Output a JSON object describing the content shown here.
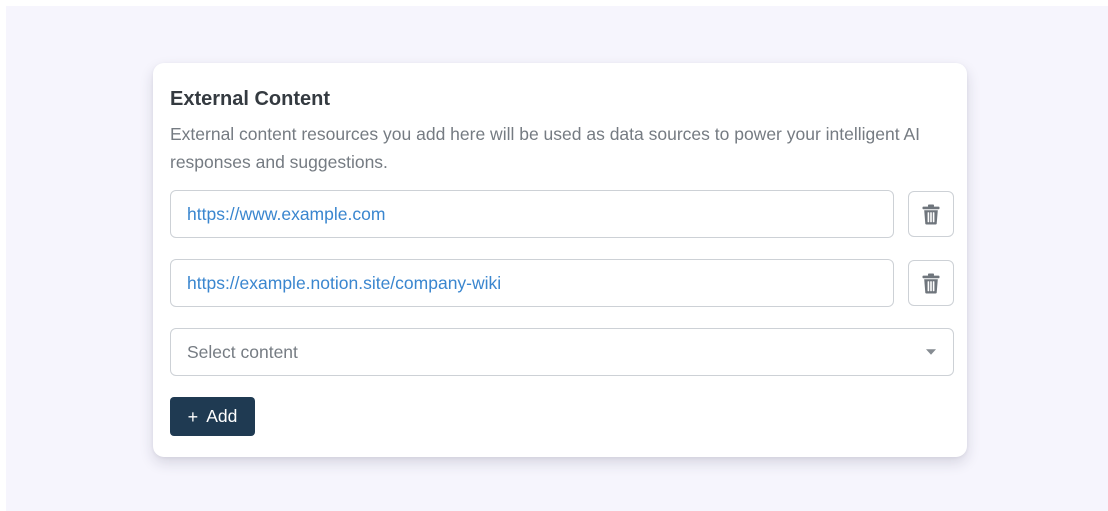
{
  "external_content": {
    "title": "External Content",
    "description": "External content resources you add here will be used as data sources to power your intelligent AI responses and suggestions.",
    "sources": [
      {
        "url": "https://www.example.com"
      },
      {
        "url": "https://example.notion.site/company-wiki"
      }
    ],
    "select": {
      "placeholder": "Select content"
    },
    "add_button": {
      "icon": "+",
      "label": "Add"
    }
  },
  "colors": {
    "page_background": "#f6f5fd",
    "card_background": "#ffffff",
    "link_text": "#3a86cf",
    "add_button_background": "#1f3a52",
    "muted_text": "#757b82",
    "border": "#cdd1d6"
  },
  "icons": {
    "delete": "trash-icon",
    "dropdown": "caret-down-icon"
  }
}
